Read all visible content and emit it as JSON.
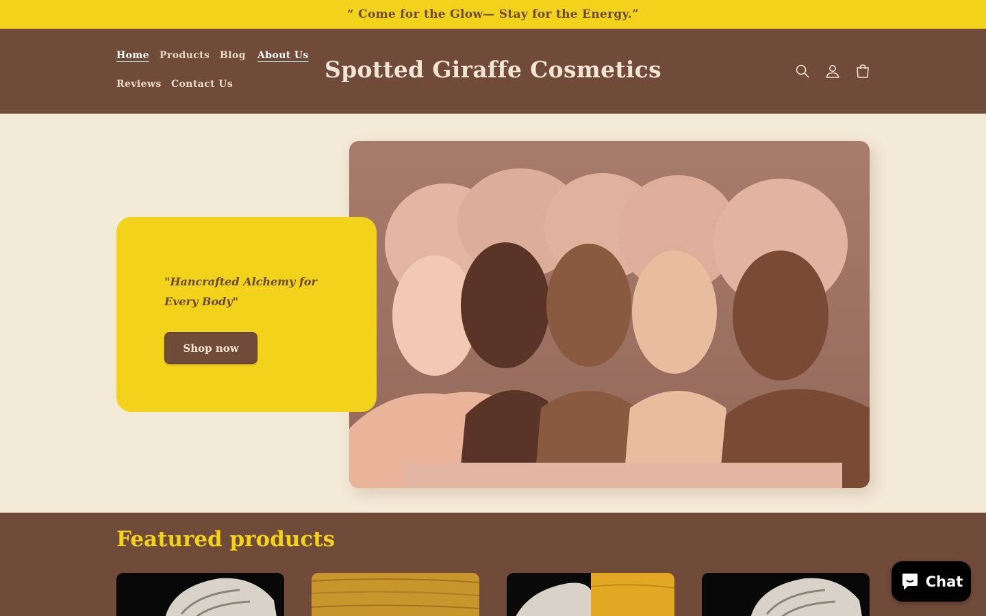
{
  "announcement": {
    "text": "“ Come for the Glow— Stay for the Energy.”"
  },
  "header": {
    "nav": [
      {
        "label": "Home",
        "active": true
      },
      {
        "label": "Products",
        "active": false
      },
      {
        "label": "Blog",
        "active": false
      },
      {
        "label": "About Us",
        "active": true
      },
      {
        "label": "Reviews",
        "active": false
      },
      {
        "label": "Contact Us",
        "active": false
      }
    ],
    "logo": "Spotted Giraffe Cosmetics",
    "icons": [
      "search-icon",
      "account-icon",
      "cart-icon"
    ]
  },
  "hero": {
    "quote": "\"Hancrafted Alchemy for Every Body\"",
    "button_label": "Shop now",
    "image": "five-women-in-pink-towel-turbans"
  },
  "featured": {
    "heading": "Featured products",
    "products": [
      {
        "image": "towel-wrap-dark"
      },
      {
        "image": "wood-grain"
      },
      {
        "image": "towel-and-wood-split"
      },
      {
        "image": "towel-wrap-dark"
      }
    ]
  },
  "chat": {
    "label": "Chat",
    "icon": "chat-bubble-icon"
  },
  "colors": {
    "accent_yellow": "#f2d21a",
    "brown": "#714b3a",
    "cream": "#f4ead8"
  }
}
